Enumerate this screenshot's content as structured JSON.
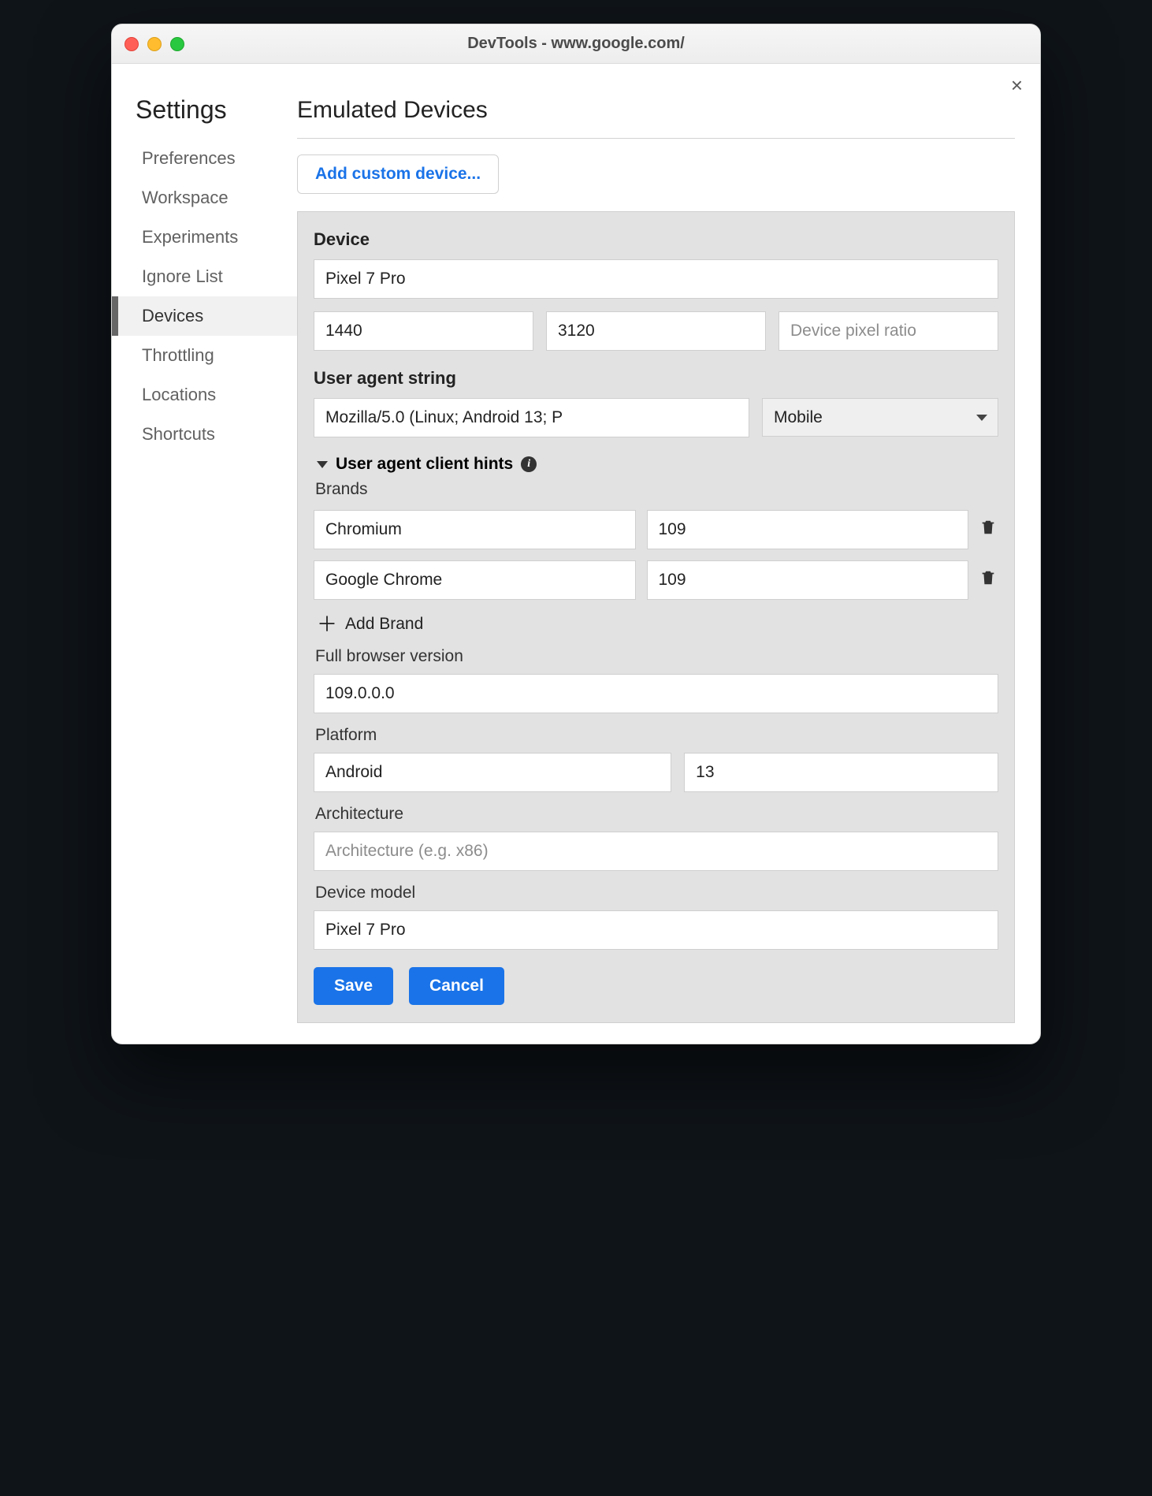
{
  "window": {
    "title": "DevTools - www.google.com/"
  },
  "sidebar": {
    "heading": "Settings",
    "items": [
      {
        "label": "Preferences"
      },
      {
        "label": "Workspace"
      },
      {
        "label": "Experiments"
      },
      {
        "label": "Ignore List"
      },
      {
        "label": "Devices",
        "active": true
      },
      {
        "label": "Throttling"
      },
      {
        "label": "Locations"
      },
      {
        "label": "Shortcuts"
      }
    ]
  },
  "main": {
    "heading": "Emulated Devices",
    "add_button": "Add custom device...",
    "form": {
      "device_label": "Device",
      "device_name": "Pixel 7 Pro",
      "width": "1440",
      "height": "3120",
      "dpr_placeholder": "Device pixel ratio",
      "ua_label": "User agent string",
      "ua_value": "Mozilla/5.0 (Linux; Android 13; P",
      "ua_type": "Mobile",
      "hints": {
        "heading": "User agent client hints",
        "brands_label": "Brands",
        "brands": [
          {
            "name": "Chromium",
            "version": "109"
          },
          {
            "name": "Google Chrome",
            "version": "109"
          }
        ],
        "add_brand": "Add Brand",
        "full_version_label": "Full browser version",
        "full_version": "109.0.0.0",
        "platform_label": "Platform",
        "platform_name": "Android",
        "platform_version": "13",
        "arch_label": "Architecture",
        "arch_placeholder": "Architecture (e.g. x86)",
        "model_label": "Device model",
        "model": "Pixel 7 Pro"
      },
      "save": "Save",
      "cancel": "Cancel"
    }
  }
}
